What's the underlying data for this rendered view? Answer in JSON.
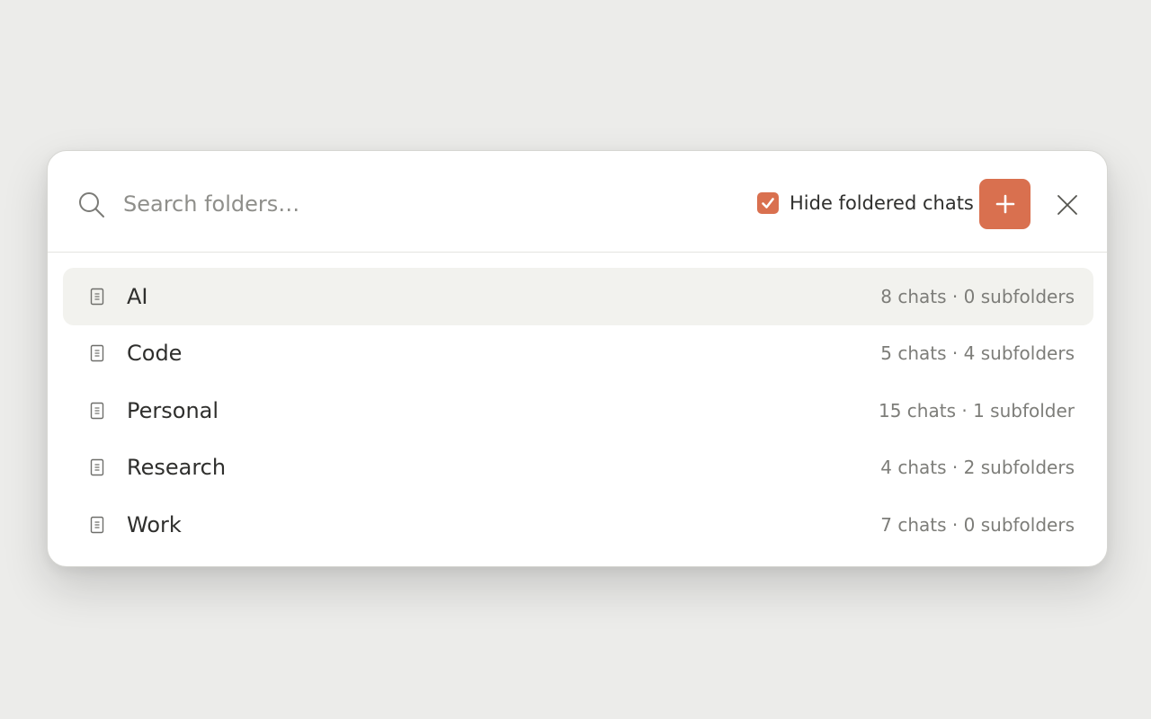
{
  "search": {
    "placeholder": "Search folders…",
    "value": ""
  },
  "header": {
    "hide_foldered_label": "Hide foldered chats",
    "hide_foldered_checked": true,
    "add_icon": "plus-icon",
    "close_icon": "close-icon"
  },
  "folders": [
    {
      "name": "AI",
      "meta": "8 chats · 0 subfolders",
      "selected": true
    },
    {
      "name": "Code",
      "meta": "5 chats · 4 subfolders",
      "selected": false
    },
    {
      "name": "Personal",
      "meta": "15 chats · 1 subfolder",
      "selected": false
    },
    {
      "name": "Research",
      "meta": "4 chats · 2 subfolders",
      "selected": false
    },
    {
      "name": "Work",
      "meta": "7 chats · 0 subfolders",
      "selected": false
    }
  ],
  "colors": {
    "accent": "#d9704f",
    "selected_row": "#f2f2ee",
    "background": "#ececea"
  }
}
